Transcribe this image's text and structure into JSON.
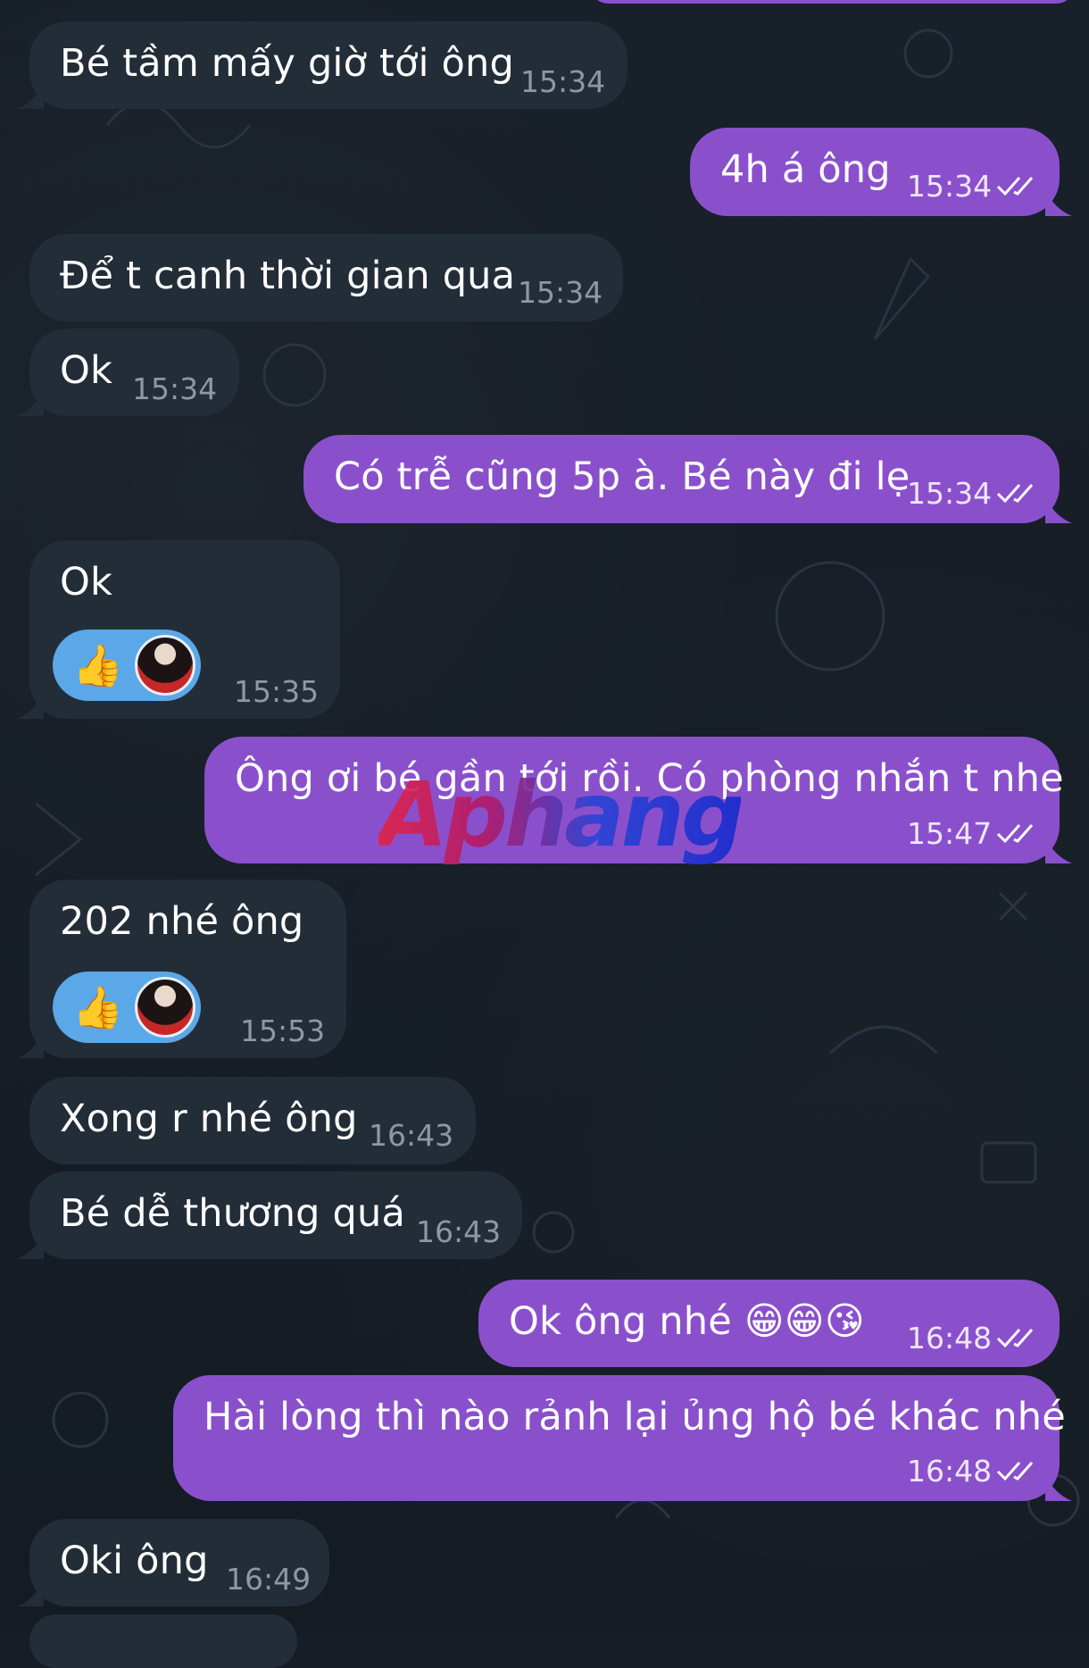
{
  "messages": [
    {
      "text": "Bé tầm mấy giờ tới ông",
      "time": "15:34",
      "dir": "in"
    },
    {
      "text": "4h á ông",
      "time": "15:34",
      "dir": "out"
    },
    {
      "text": "Để t canh thời gian qua",
      "time": "15:34",
      "dir": "in"
    },
    {
      "text": "Ok",
      "time": "15:34",
      "dir": "in"
    },
    {
      "text": "Có trễ cũng 5p à. Bé này đi lẹ",
      "time": "15:34",
      "dir": "out"
    },
    {
      "text": "Ok",
      "time": "15:35",
      "dir": "in",
      "reaction": "thumbs-up"
    },
    {
      "text": "Ông ơi bé gần tới rồi. Có phòng nhắn t nhe",
      "time": "15:47",
      "dir": "out"
    },
    {
      "text": "202 nhé ông",
      "time": "15:53",
      "dir": "in",
      "reaction": "thumbs-up"
    },
    {
      "text": "Xong r nhé ông",
      "time": "16:43",
      "dir": "in"
    },
    {
      "text": "Bé dễ thương quá",
      "time": "16:43",
      "dir": "in"
    },
    {
      "text": "Ok ông nhé 😁😁😘",
      "time": "16:48",
      "dir": "out"
    },
    {
      "text": "Hài lòng thì nào rảnh lại ủng hộ bé khác nhé",
      "time": "16:48",
      "dir": "out"
    },
    {
      "text": "Oki ông",
      "time": "16:49",
      "dir": "in"
    }
  ],
  "reaction_emoji": "👍",
  "watermark": "Aphang",
  "colors": {
    "background": "#161d26",
    "incoming_bubble": "#232d38",
    "outgoing_bubble": "#8a50cc",
    "read_ticks": "#ffffff"
  },
  "icons": {
    "read_receipt": "double-check-icon",
    "reaction_avatar": "avatar"
  }
}
